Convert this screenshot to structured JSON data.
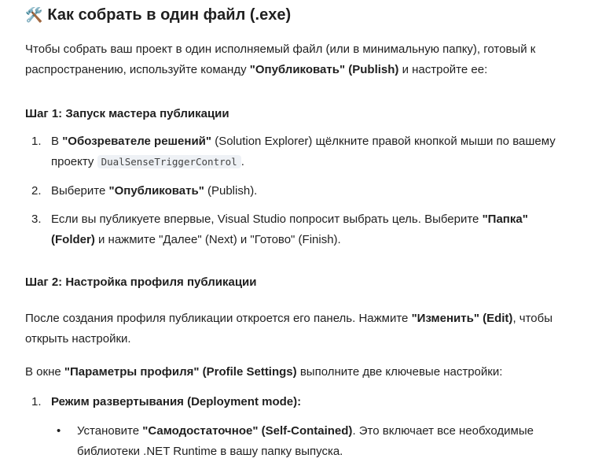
{
  "title": {
    "icon": "🛠️",
    "text": "Как собрать в один файл (.exe)"
  },
  "intro": {
    "pre": "Чтобы собрать ваш проект в один исполняемый файл (или в минимальную папку), готовый к распространению, используйте команду ",
    "bold": "\"Опубликовать\" (Publish)",
    "post": " и настройте ее:"
  },
  "step1": {
    "heading": "Шаг 1: Запуск мастера публикации",
    "items": [
      {
        "num": "1.",
        "pre": "В ",
        "bold": "\"Обозревателе решений\"",
        "mid": " (Solution Explorer) щёлкните правой кнопкой мыши по вашему проекту ",
        "code": "DualSenseTriggerControl",
        "post": "."
      },
      {
        "num": "2.",
        "pre": "Выберите ",
        "bold": "\"Опубликовать\"",
        "post": " (Publish)."
      },
      {
        "num": "3.",
        "pre": "Если вы публикуете впервые, Visual Studio попросит выбрать цель. Выберите ",
        "bold": "\"Папка\" (Folder)",
        "post": " и нажмите \"Далее\" (Next) и \"Готово\" (Finish)."
      }
    ]
  },
  "step2": {
    "heading": "Шаг 2: Настройка профиля публикации",
    "p1": {
      "pre": "После создания профиля публикации откроется его панель. Нажмите ",
      "bold": "\"Изменить\" (Edit)",
      "post": ", чтобы открыть настройки."
    },
    "p2": {
      "pre": "В окне ",
      "bold": "\"Параметры профиля\" (Profile Settings)",
      "post": " выполните две ключевые настройки:"
    },
    "item1": {
      "num": "1.",
      "bold": "Режим развертывания (Deployment mode):"
    },
    "bullet1": {
      "bullet": "•",
      "pre": "Установите ",
      "bold": "\"Самодостаточное\" (Self-Contained)",
      "post": ". Это включает все необходимые библиотеки .NET Runtime в вашу папку выпуска."
    }
  }
}
